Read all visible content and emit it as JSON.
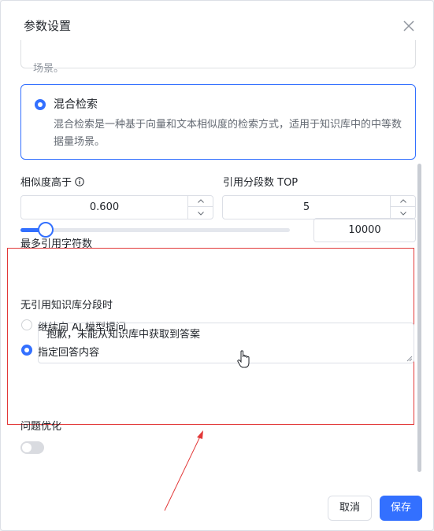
{
  "dialog": {
    "title": "参数设置",
    "close_icon": "close-icon"
  },
  "prev_card": {
    "description": "场景。"
  },
  "hybrid_card": {
    "selected": true,
    "title": "混合检索",
    "description": "混合检索是一种基于向量和文本相似度的检索方式，适用于知识库中的中等数据量场景。"
  },
  "similarity": {
    "label": "相似度高于",
    "info_icon": "info-icon",
    "value": "0.600"
  },
  "top": {
    "label": "引用分段数 TOP",
    "value": "5"
  },
  "max_chars": {
    "label": "最多引用字符数",
    "value": "10000",
    "slider_fraction": 0.1
  },
  "no_ref": {
    "label": "无引用知识库分段时",
    "options": [
      {
        "label": "继续向 AI 模型提问",
        "selected": false
      },
      {
        "label": "指定回答内容",
        "selected": true
      }
    ],
    "answer_text": "抱歉，未能从知识库中获取到答案"
  },
  "question_opt": {
    "label": "问题优化",
    "enabled": false
  },
  "footer": {
    "cancel_label": "取消",
    "save_label": "保存"
  },
  "colors": {
    "accent": "#3370ff",
    "annotation": "#e23838"
  }
}
